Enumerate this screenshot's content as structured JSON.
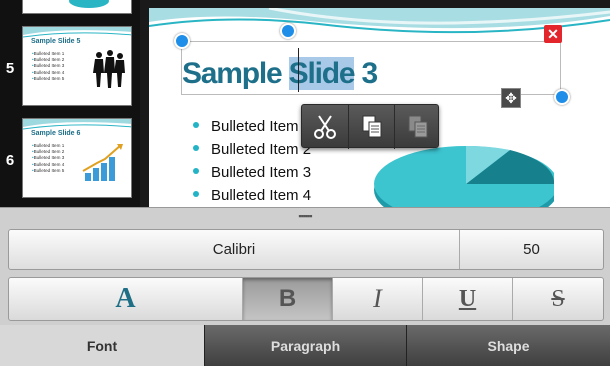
{
  "thumbnails": [
    {
      "number": "5",
      "title": "Sample Slide 5",
      "bullets": [
        "Bulleted Item 1",
        "Bulleted Item 2",
        "Bulleted Item 3",
        "Bulleted Item 4",
        "Bulleted Item 5"
      ],
      "art": "people-silhouette-icon"
    },
    {
      "number": "6",
      "title": "Sample Slide 6",
      "bullets": [
        "Bulleted Item 1",
        "Bulleted Item 2",
        "Bulleted Item 3",
        "Bulleted Item 4",
        "Bulleted Item 5"
      ],
      "art": "growth-chart-icon"
    }
  ],
  "slide": {
    "title_before": "Sample ",
    "title_selected": "Slide",
    "title_after": " 3",
    "bullets": [
      "Bulleted Item 1",
      "Bulleted Item 2",
      "Bulleted Item 3",
      "Bulleted Item 4"
    ]
  },
  "context_menu": {
    "move_icon": "move-icon",
    "items": [
      "cut-icon",
      "copy-icon",
      "paste-icon"
    ]
  },
  "format_panel": {
    "font_name": "Calibri",
    "font_size": "50",
    "buttons": [
      {
        "label": "A",
        "name": "font-color-button",
        "active": false
      },
      {
        "label": "B",
        "name": "bold-button",
        "active": true
      },
      {
        "label": "I",
        "name": "italic-button",
        "active": false
      },
      {
        "label": "U",
        "name": "underline-button",
        "active": false
      },
      {
        "label": "S",
        "name": "strikethrough-button",
        "active": false
      }
    ],
    "tabs": [
      {
        "label": "Font",
        "active": true
      },
      {
        "label": "Paragraph",
        "active": false
      },
      {
        "label": "Shape",
        "active": false
      }
    ]
  },
  "colors": {
    "accent": "#1e8ee8",
    "title": "#1d6f8a",
    "close": "#e2262c",
    "bullet": "#22b4c6"
  }
}
